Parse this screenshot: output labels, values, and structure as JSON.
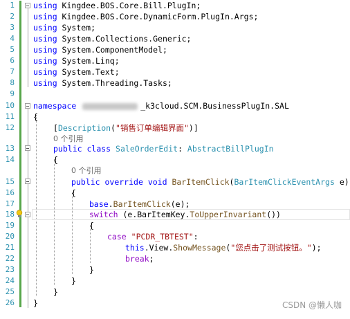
{
  "editor": {
    "line_numbers": [
      "1",
      "2",
      "3",
      "4",
      "5",
      "6",
      "7",
      "8",
      "9",
      "10",
      "11",
      "12",
      "13",
      "14",
      "15",
      "16",
      "17",
      "18",
      "19",
      "20",
      "21",
      "22",
      "23",
      "24",
      "25",
      "26"
    ],
    "usings": [
      {
        "kw": "using",
        "ns": " Kingdee.BOS.Core.Bill.PlugIn;"
      },
      {
        "kw": "using",
        "ns": " Kingdee.BOS.Core.DynamicForm.PlugIn.Args;"
      },
      {
        "kw": "using",
        "ns": " System;"
      },
      {
        "kw": "using",
        "ns": " System.Collections.Generic;"
      },
      {
        "kw": "using",
        "ns": " System.ComponentModel;"
      },
      {
        "kw": "using",
        "ns": " System.Linq;"
      },
      {
        "kw": "using",
        "ns": " System.Text;"
      },
      {
        "kw": "using",
        "ns": " System.Threading.Tasks;"
      }
    ],
    "namespace_kw": "namespace",
    "namespace_name": "_k3cloud.SCM.BusinessPlugIn.SAL",
    "attr_open": "[",
    "attr_name": "Description",
    "attr_paren_open": "(",
    "attr_string": "\"销售订单编辑界面\"",
    "attr_close": ")]",
    "ref_count_1": "0 个引用",
    "class_public": "public",
    "class_kw": "class",
    "class_name": "SaleOrderEdit",
    "class_colon": ": ",
    "base_class": "AbstractBillPlugIn",
    "ref_count_2": "0 个引用",
    "method_public": "public",
    "method_override": "override",
    "method_void": "void",
    "method_name": "BarItemClick",
    "param_open": "(",
    "param_type": "BarItemClickEventArgs",
    "param_rest": " e)",
    "base_kw": "base",
    "base_call_dot": ".",
    "base_call_name": "BarItemClick",
    "base_call_rest": "(e);",
    "switch_kw": "switch",
    "switch_expr_a": " (e.BarItemKey.",
    "switch_method": "ToUpperInvariant",
    "switch_expr_b": "())",
    "case_kw": "case",
    "case_value": "\"PCDR_TBTEST\"",
    "case_colon": ":",
    "this_kw": "this",
    "view_part": ".View.",
    "show_method": "ShowMessage",
    "msg_open": "(",
    "msg_string": "\"您点击了测试按钮。\"",
    "msg_close": ");",
    "break_kw": "break",
    "semicolon": ";",
    "brace_open": "{",
    "brace_close": "}"
  },
  "watermark": "CSDN @懒人咖",
  "colors": {
    "keyword": "#0000ff",
    "type": "#2b91af",
    "string": "#a31515",
    "method": "#74531f",
    "control_keyword": "#8f08c4",
    "line_number": "#2b91af",
    "change_bar": "#57a64a"
  }
}
